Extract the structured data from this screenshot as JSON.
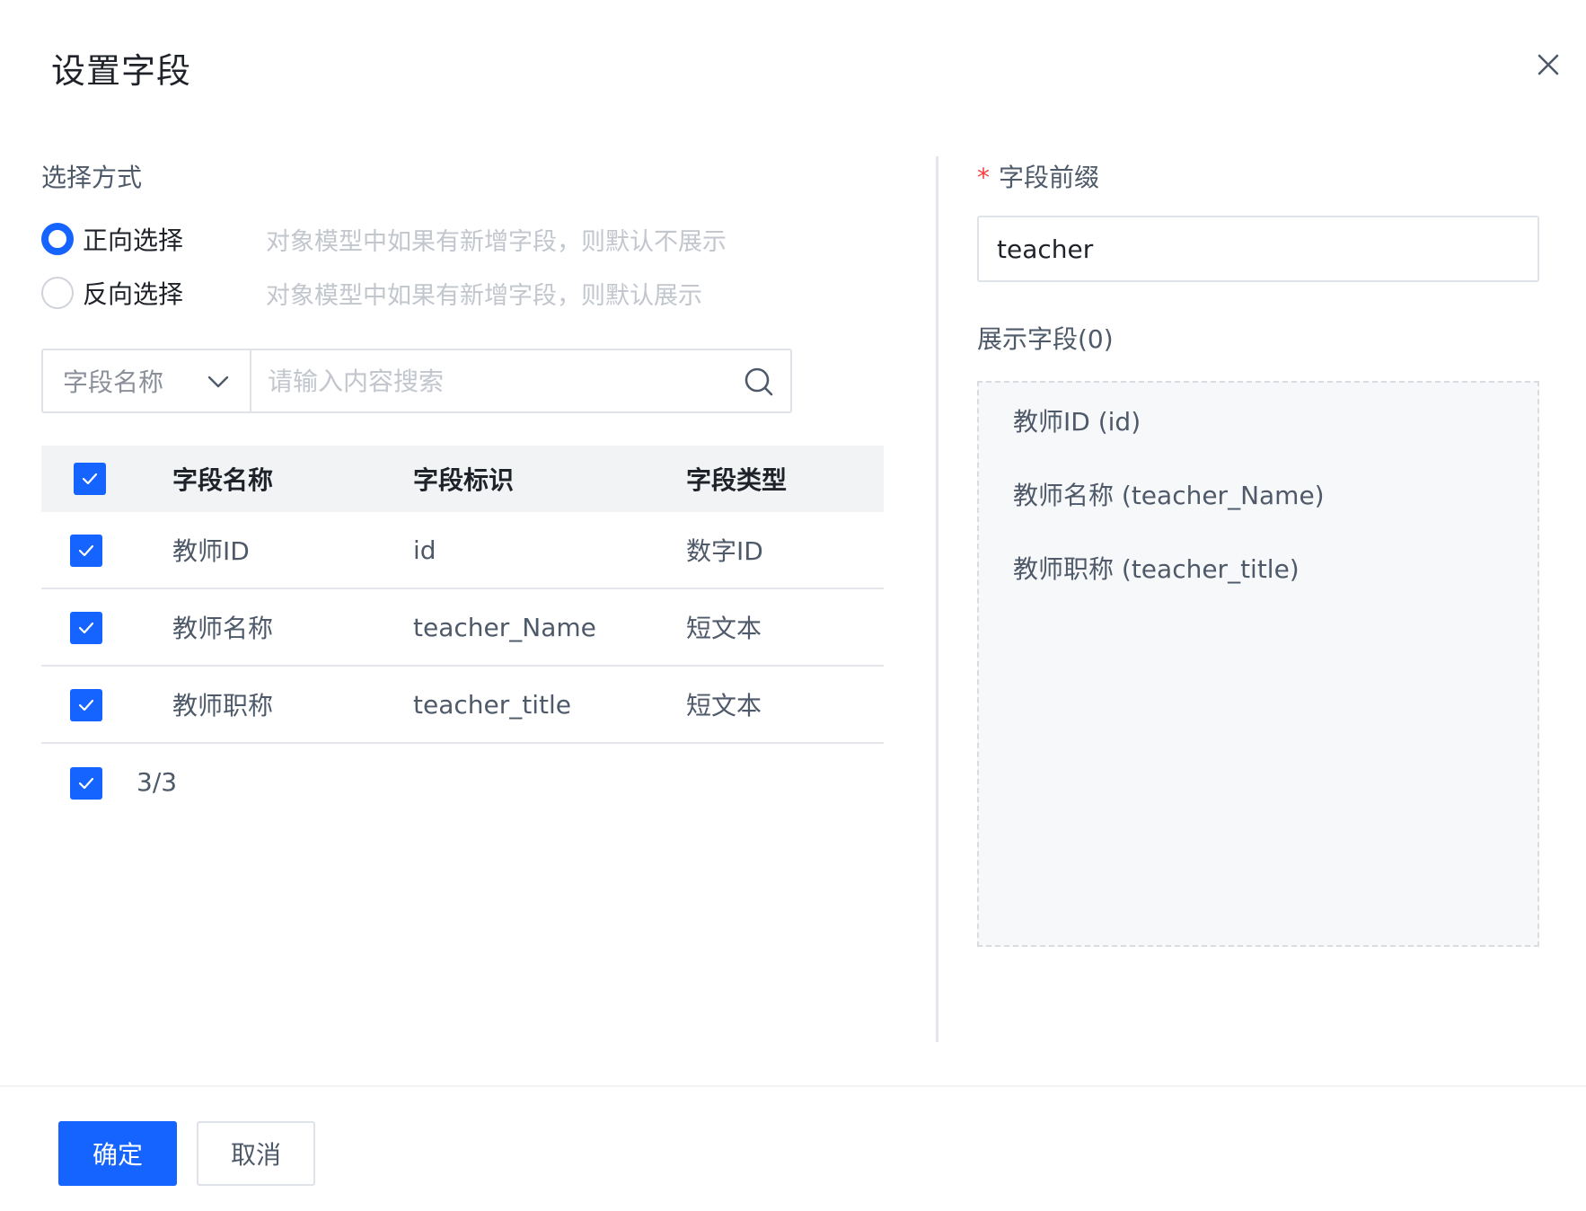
{
  "dialog": {
    "title": "设置字段",
    "close_icon": "close-icon"
  },
  "selection": {
    "label": "选择方式",
    "options": [
      {
        "label": "正向选择",
        "hint": "对象模型中如果有新增字段，则默认不展示",
        "checked": true
      },
      {
        "label": "反向选择",
        "hint": "对象模型中如果有新增字段，则默认展示",
        "checked": false
      }
    ]
  },
  "search": {
    "field_select": "字段名称",
    "placeholder": "请输入内容搜索",
    "value": ""
  },
  "table": {
    "headers": [
      "字段名称",
      "字段标识",
      "字段类型"
    ],
    "header_checked": true,
    "rows": [
      {
        "name": "教师ID",
        "key": "id",
        "type": "数字ID",
        "checked": true
      },
      {
        "name": "教师名称",
        "key": "teacher_Name",
        "type": "短文本",
        "checked": true
      },
      {
        "name": "教师职称",
        "key": "teacher_title",
        "type": "短文本",
        "checked": true
      }
    ],
    "footer_count": "3/3"
  },
  "prefix": {
    "required_mark": "*",
    "label": "字段前缀",
    "value": "teacher"
  },
  "display": {
    "label": "展示字段(0)",
    "items": [
      "教师ID (id)",
      "教师名称 (teacher_Name)",
      "教师职称 (teacher_title)"
    ]
  },
  "actions": {
    "ok": "确定",
    "cancel": "取消"
  },
  "colors": {
    "primary": "#1664ff",
    "required": "#f53f3f"
  }
}
